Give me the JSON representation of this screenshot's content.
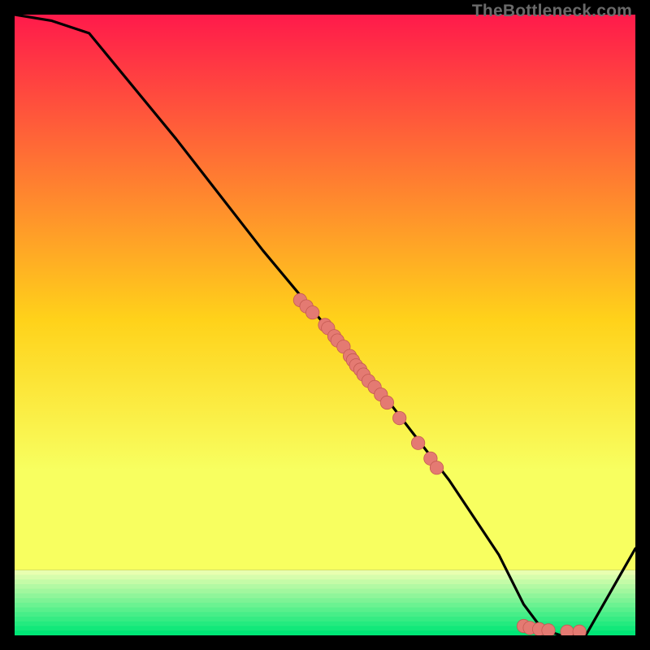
{
  "watermark": "TheBottleneck.com",
  "colors": {
    "top": "#ff1a4b",
    "mid_upper": "#ffd21a",
    "mid_lower": "#f8ff60",
    "band_pale": "#e8ffb0",
    "band_green": "#00e676",
    "curve": "#000000",
    "point_fill": "#e47a72",
    "point_stroke": "#c45a52"
  },
  "chart_data": {
    "type": "line",
    "title": "",
    "xlabel": "",
    "ylabel": "",
    "xlim": [
      0,
      100
    ],
    "ylim": [
      0,
      100
    ],
    "series": [
      {
        "name": "bottleneck-curve",
        "x": [
          0,
          6,
          12,
          26,
          40,
          50,
          60,
          70,
          78,
          82,
          85,
          88,
          90,
          92,
          100
        ],
        "y": [
          100,
          99,
          97,
          80,
          62,
          50,
          38,
          25,
          13,
          5,
          1,
          0,
          0,
          0,
          14
        ]
      }
    ],
    "scatter": [
      {
        "name": "measured-points",
        "x": [
          46,
          47,
          48,
          50,
          50.5,
          51.5,
          52,
          53,
          54,
          54.5,
          55,
          55.7,
          56.2,
          57,
          58,
          59,
          60,
          62,
          65,
          67,
          68,
          82,
          83,
          84.5,
          86,
          89,
          91
        ],
        "y": [
          54,
          53,
          52,
          50,
          49.5,
          48.2,
          47.5,
          46.5,
          45,
          44.3,
          43.5,
          42.8,
          42,
          41,
          40,
          38.8,
          37.5,
          35,
          31,
          28.5,
          27,
          1.5,
          1.2,
          1.0,
          0.8,
          0.6,
          0.6
        ]
      }
    ]
  }
}
